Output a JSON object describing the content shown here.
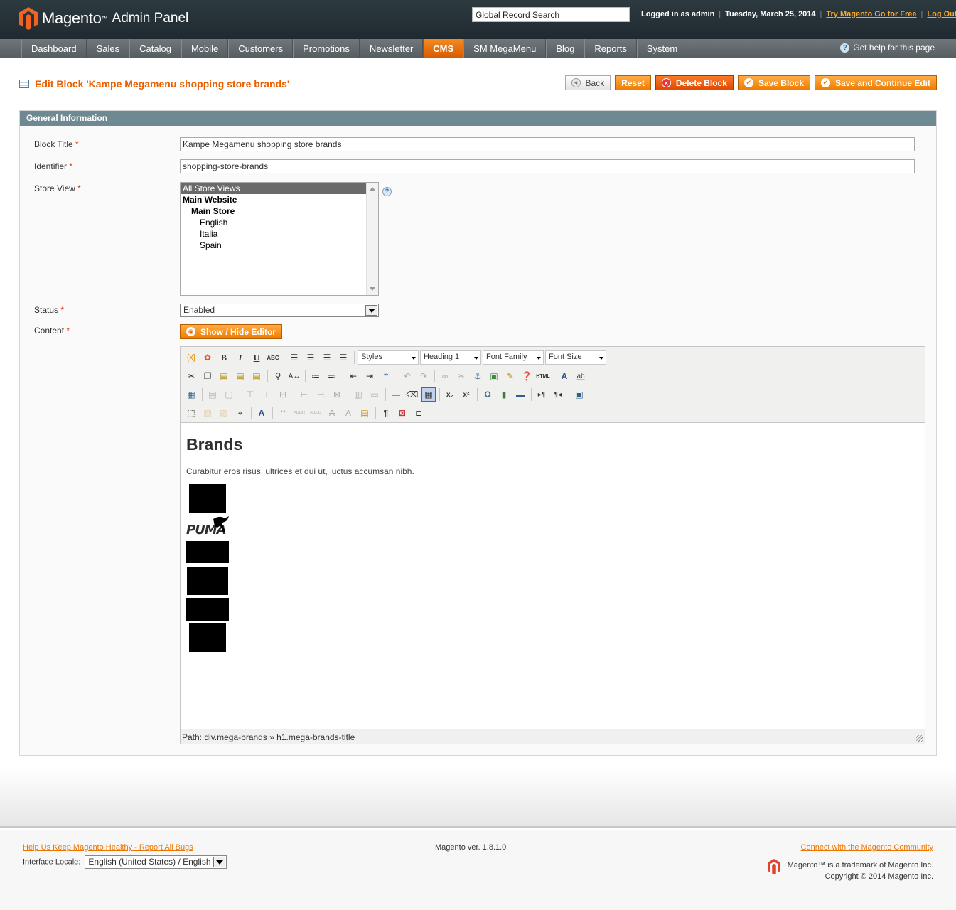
{
  "header": {
    "brand": "Magento",
    "brand_sub": "Admin Panel",
    "search_placeholder": "Global Record Search",
    "logged_in": "Logged in as admin",
    "date": "Tuesday, March 25, 2014",
    "try_link": "Try Magento Go for Free",
    "logout": "Log Out"
  },
  "nav": {
    "items": [
      "Dashboard",
      "Sales",
      "Catalog",
      "Mobile",
      "Customers",
      "Promotions",
      "Newsletter",
      "CMS",
      "SM MegaMenu",
      "Blog",
      "Reports",
      "System"
    ],
    "active": "CMS",
    "help": "Get help for this page"
  },
  "page": {
    "title": "Edit Block 'Kampe Megamenu shopping store brands'",
    "buttons": {
      "back": "Back",
      "reset": "Reset",
      "delete": "Delete Block",
      "save": "Save Block",
      "save_continue": "Save and Continue Edit"
    }
  },
  "form": {
    "section": "General Information",
    "block_title_label": "Block Title",
    "block_title_value": "Kampe Megamenu shopping store brands",
    "identifier_label": "Identifier",
    "identifier_value": "shopping-store-brands",
    "store_view_label": "Store View",
    "store_views": [
      "All Store Views",
      "Main Website",
      "Main Store",
      "English",
      "Italia",
      "Spain"
    ],
    "status_label": "Status",
    "status_value": "Enabled",
    "content_label": "Content",
    "toggle_editor": "Show / Hide Editor",
    "required_mark": "*"
  },
  "editor": {
    "selects": [
      "Styles",
      "Heading 1",
      "Font Family",
      "Font Size"
    ],
    "heading": "Brands",
    "paragraph": "Curabitur eros risus, ultrices et dui ut, luctus accumsan nibh.",
    "logo_text": "PUMA",
    "path": "Path: div.mega-brands » h1.mega-brands-title"
  },
  "footer": {
    "report_link": "Help Us Keep Magento Healthy - Report All Bugs",
    "locale_label": "Interface Locale:",
    "locale_value": "English (United States) / English",
    "version": "Magento ver. 1.8.1.0",
    "community_link": "Connect with the Magento Community",
    "trademark": "Magento™ is a trademark of Magento Inc.",
    "copyright": "Copyright © 2014 Magento Inc."
  },
  "colors": {
    "accent": "#eb5e00",
    "nav_active": "#f07d00",
    "header_bg": "#2d3a40",
    "section_bg": "#6f8992"
  }
}
